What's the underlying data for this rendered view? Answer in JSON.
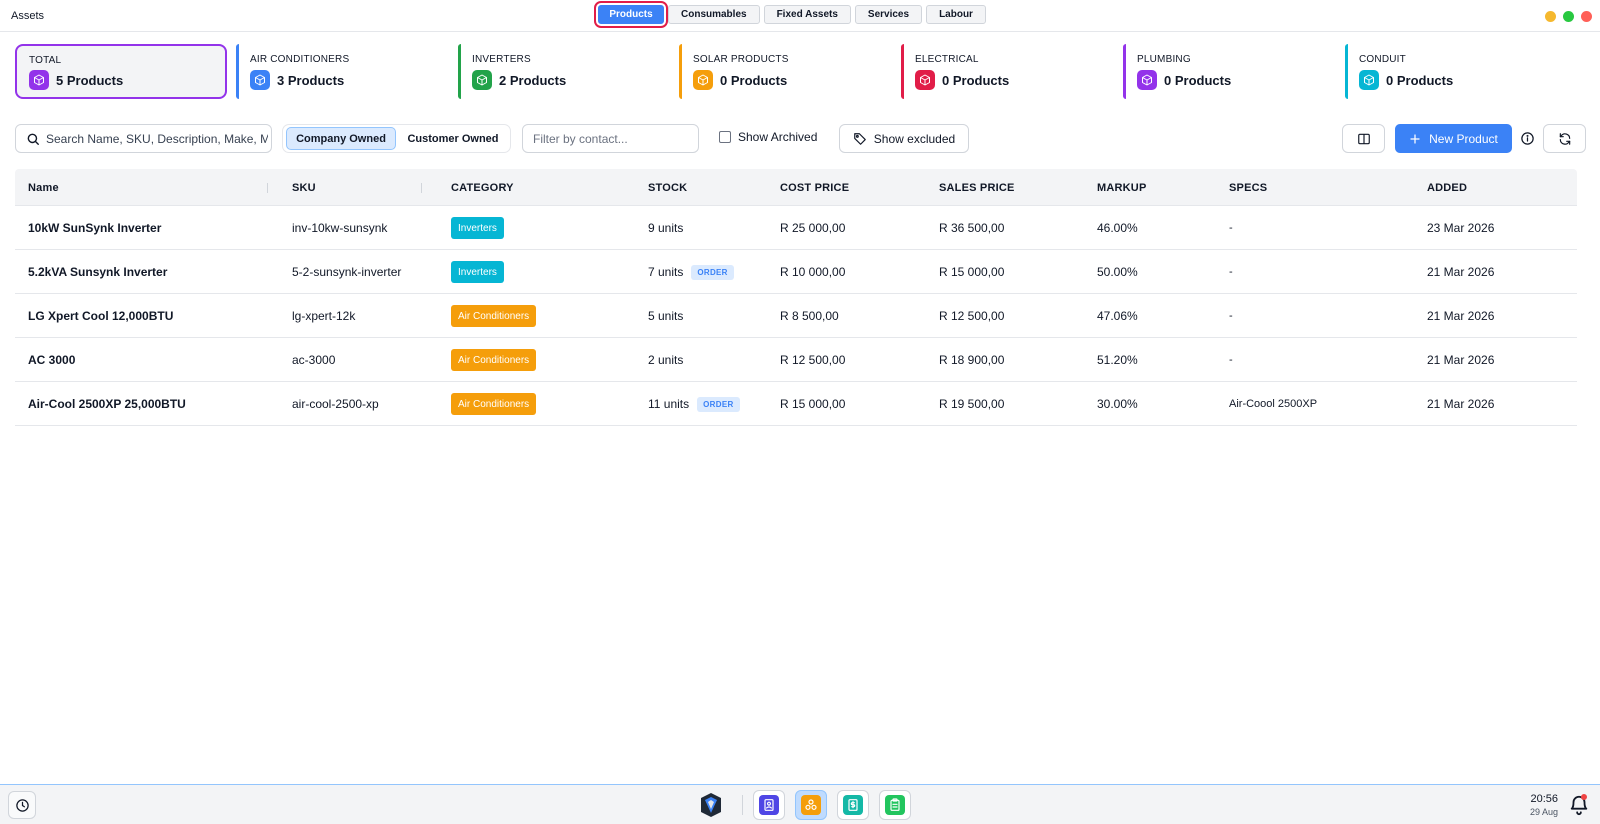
{
  "window": {
    "title": "Assets",
    "tabs": [
      {
        "label": "Products",
        "active": true
      },
      {
        "label": "Consumables",
        "active": false
      },
      {
        "label": "Fixed Assets",
        "active": false
      },
      {
        "label": "Services",
        "active": false
      },
      {
        "label": "Labour",
        "active": false
      }
    ],
    "controls": {
      "minimize_color": "#f5b82e",
      "maximize_color": "#28c840",
      "close_color": "#ff5f57"
    }
  },
  "category_cards": [
    {
      "label": "TOTAL",
      "count": "5 Products",
      "color": "#9333ea",
      "icon": "box-icon"
    },
    {
      "label": "AIR CONDITIONERS",
      "count": "3 Products",
      "color": "#3b82f6",
      "icon": "box-icon"
    },
    {
      "label": "INVERTERS",
      "count": "2 Products",
      "color": "#22a34a",
      "icon": "box-icon"
    },
    {
      "label": "SOLAR PRODUCTS",
      "count": "0 Products",
      "color": "#f59e0b",
      "icon": "box-icon"
    },
    {
      "label": "ELECTRICAL",
      "count": "0 Products",
      "color": "#e11d48",
      "icon": "box-icon"
    },
    {
      "label": "PLUMBING",
      "count": "0 Products",
      "color": "#9333ea",
      "icon": "box-icon"
    },
    {
      "label": "CONDUIT",
      "count": "0 Products",
      "color": "#06b6d4",
      "icon": "box-icon"
    }
  ],
  "toolbar": {
    "search_placeholder": "Search Name, SKU, Description, Make, Model",
    "owner_options": [
      "Company Owned",
      "Customer Owned"
    ],
    "owner_selected": "Company Owned",
    "contact_placeholder": "Filter by contact...",
    "show_archived_label": "Show Archived",
    "show_archived_checked": false,
    "show_excluded_label": "Show excluded",
    "new_product_label": "New Product",
    "accent_color": "#3b82f6"
  },
  "table": {
    "columns": [
      "Name",
      "SKU",
      "CATEGORY",
      "STOCK",
      "COST PRICE",
      "SALES PRICE",
      "MARKUP",
      "SPECS",
      "ADDED"
    ],
    "rows": [
      {
        "name": "10kW SunSynk Inverter",
        "sku": "inv-10kw-sunsynk",
        "category": "Inverters",
        "category_color": "#06b6d4",
        "stock": "9 units",
        "order": "",
        "cost": "R 25 000,00",
        "sales": "R 36 500,00",
        "markup": "46.00%",
        "specs": "-",
        "added": "23 Mar 2026"
      },
      {
        "name": "5.2kVA Sunsynk Inverter",
        "sku": "5-2-sunsynk-inverter",
        "category": "Inverters",
        "category_color": "#06b6d4",
        "stock": "7 units",
        "order": "ORDER",
        "cost": "R 10 000,00",
        "sales": "R 15 000,00",
        "markup": "50.00%",
        "specs": "-",
        "added": "21 Mar 2026"
      },
      {
        "name": "LG Xpert Cool 12,000BTU",
        "sku": "lg-xpert-12k",
        "category": "Air Conditioners",
        "category_color": "#f59e0b",
        "stock": "5 units",
        "order": "",
        "cost": "R 8 500,00",
        "sales": "R 12 500,00",
        "markup": "47.06%",
        "specs": "-",
        "added": "21 Mar 2026"
      },
      {
        "name": "AC 3000",
        "sku": "ac-3000",
        "category": "Air Conditioners",
        "category_color": "#f59e0b",
        "stock": "2 units",
        "order": "",
        "cost": "R 12 500,00",
        "sales": "R 18 900,00",
        "markup": "51.20%",
        "specs": "-",
        "added": "21 Mar 2026"
      },
      {
        "name": "Air-Cool 2500XP 25,000BTU",
        "sku": "air-cool-2500-xp",
        "category": "Air Conditioners",
        "category_color": "#f59e0b",
        "stock": "11 units",
        "order": "ORDER",
        "cost": "R 15 000,00",
        "sales": "R 19 500,00",
        "markup": "30.00%",
        "specs": "Air-Coool 2500XP",
        "added": "21 Mar 2026"
      }
    ]
  },
  "taskbar": {
    "apps": [
      {
        "icon": "contacts-icon",
        "color": "#4f46e5",
        "active": false
      },
      {
        "icon": "assets-icon",
        "color": "#f59e0b",
        "active": true
      },
      {
        "icon": "invoice-icon",
        "color": "#14b8a6",
        "active": false
      },
      {
        "icon": "clipboard-icon",
        "color": "#22c55e",
        "active": false
      }
    ],
    "time": "20:56",
    "date": "29 Aug"
  }
}
